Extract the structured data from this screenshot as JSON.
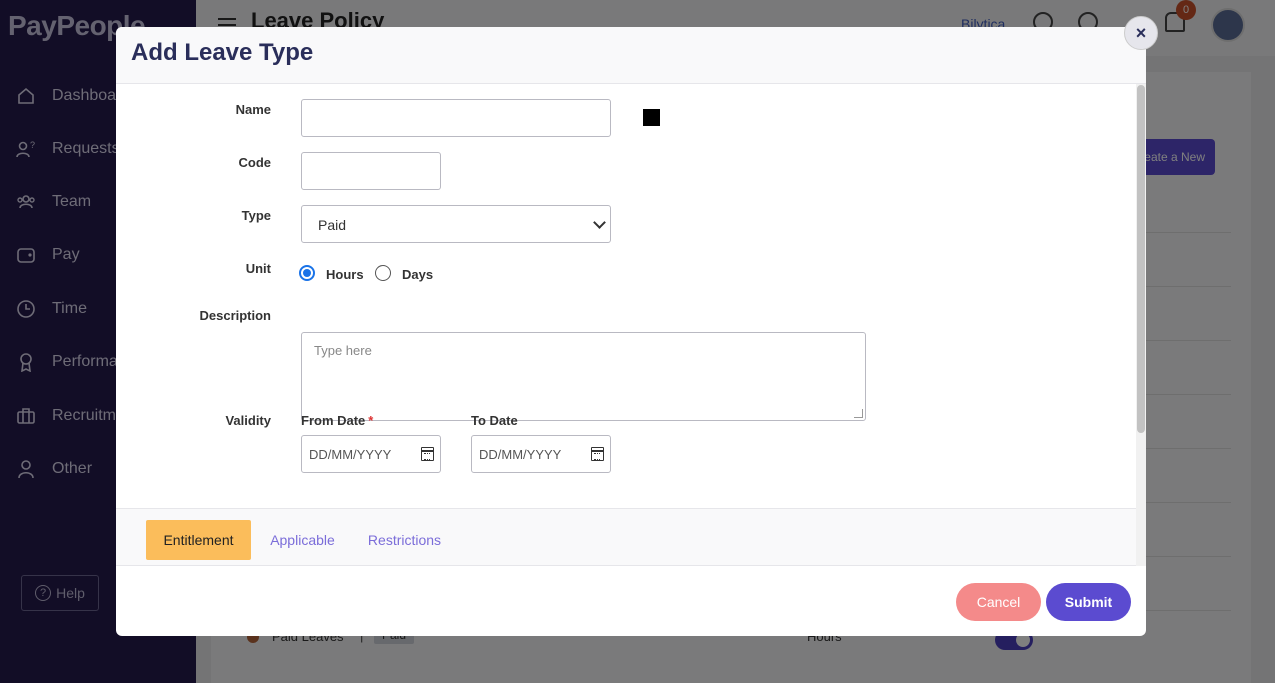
{
  "app": {
    "brand": "PayPeople",
    "company": "Bilytica",
    "page_title": "Leave Policy",
    "notification_count": "0",
    "create_button": "Create a New",
    "help": "Help"
  },
  "sidebar": {
    "items": [
      {
        "label": "Dashboard",
        "icon": "home-icon"
      },
      {
        "label": "Requests",
        "icon": "requests-icon"
      },
      {
        "label": "Team",
        "icon": "team-icon"
      },
      {
        "label": "Pay",
        "icon": "wallet-icon"
      },
      {
        "label": "Time",
        "icon": "clock-icon"
      },
      {
        "label": "Performance",
        "icon": "award-icon"
      },
      {
        "label": "Recruitment",
        "icon": "briefcase-icon"
      },
      {
        "label": "Other",
        "icon": "user-icon"
      }
    ]
  },
  "background_row": {
    "name": "Paid Leaves",
    "type": "Paid",
    "unit": "Hours"
  },
  "modal": {
    "title": "Add Leave Type",
    "close_icon": "×",
    "fields": {
      "name_label": "Name",
      "name_value": "",
      "color_value": "#000000",
      "code_label": "Code",
      "code_value": "",
      "type_label": "Type",
      "type_value": "Paid",
      "unit_label": "Unit",
      "unit_options": [
        "Hours",
        "Days"
      ],
      "unit_selected": "Hours",
      "description_label": "Description",
      "description_placeholder": "Type here",
      "validity_label": "Validity",
      "from_date_label": "From Date",
      "from_date_required": "*",
      "from_date_placeholder": "DD/MM/YYYY",
      "to_date_label": "To Date",
      "to_date_placeholder": "DD/MM/YYYY"
    },
    "tabs": [
      {
        "label": "Entitlement",
        "active": true
      },
      {
        "label": "Applicable",
        "active": false
      },
      {
        "label": "Restrictions",
        "active": false
      }
    ],
    "buttons": {
      "cancel": "Cancel",
      "submit": "Submit"
    }
  },
  "colors": {
    "sidebar": "#251a4d",
    "primary": "#5b4bd0",
    "cancel": "#f48a8a",
    "active_tab": "#fbbd5b",
    "tab_link": "#7b6dd9",
    "title": "#2a2e5a"
  }
}
